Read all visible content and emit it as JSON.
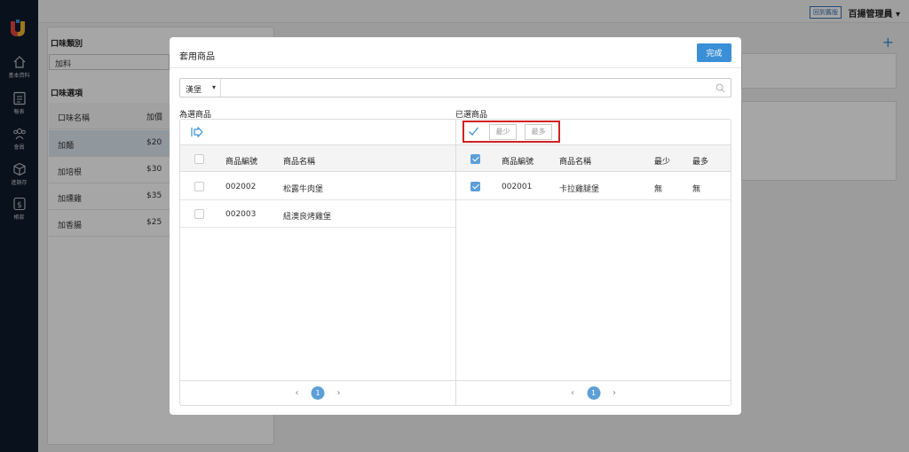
{
  "topbar": {
    "back_link": "回到舊版",
    "user": "百揚管理員 ▾"
  },
  "sidebar": {
    "items": [
      {
        "label": "基本資料",
        "icon": "home-icon"
      },
      {
        "label": "報表",
        "icon": "report-icon"
      },
      {
        "label": "會員",
        "icon": "members-icon"
      },
      {
        "label": "進銷存",
        "icon": "box-icon"
      },
      {
        "label": "帳款",
        "icon": "dollar-icon"
      }
    ]
  },
  "background": {
    "category_label": "口味類別",
    "category_value": "加料",
    "options_label": "口味選項",
    "col_name": "口味名稱",
    "col_price": "加價",
    "rows": [
      {
        "name": "加麵",
        "price": "$20"
      },
      {
        "name": "加培根",
        "price": "$30"
      },
      {
        "name": "加燻雞",
        "price": "$35"
      },
      {
        "name": "加香腸",
        "price": "$25"
      }
    ]
  },
  "modal": {
    "title": "套用商品",
    "done_label": "完成",
    "search": {
      "select_value": "漢堡",
      "placeholder": ""
    },
    "left": {
      "label": "為選商品",
      "columns": {
        "code": "商品編號",
        "name": "商品名稱"
      },
      "rows": [
        {
          "code": "002002",
          "name": "松露牛肉堡"
        },
        {
          "code": "002003",
          "name": "紐澳良烤雞堡"
        }
      ],
      "page": "1"
    },
    "right": {
      "label": "已選商品",
      "min_placeholder": "最少",
      "max_placeholder": "最多",
      "columns": {
        "code": "商品編號",
        "name": "商品名稱",
        "min": "最少",
        "max": "最多"
      },
      "rows": [
        {
          "code": "002001",
          "name": "卡拉雞腿堡",
          "min": "無",
          "max": "無"
        }
      ],
      "page": "1"
    }
  },
  "colors": {
    "accent": "#3a8fd6",
    "highlight": "#d32020",
    "sidebar": "#0f1b2b"
  }
}
